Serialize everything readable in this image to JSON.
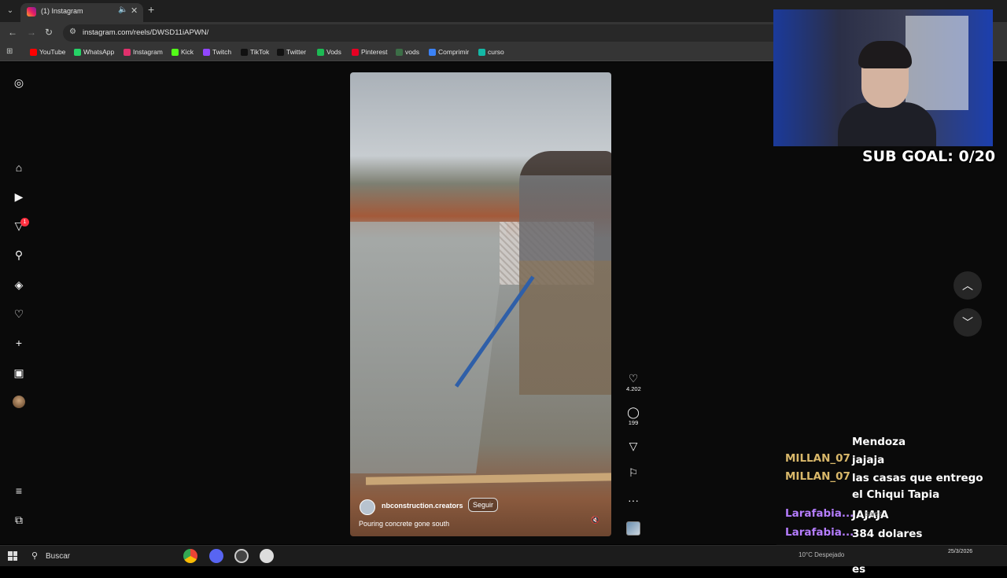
{
  "browser": {
    "tab": {
      "title": "(1) Instagram"
    },
    "address": {
      "url": "instagram.com/reels/DWSD11iAPWN/"
    },
    "bookmarks": [
      {
        "label": "YouTube",
        "color": "#ff0000"
      },
      {
        "label": "WhatsApp",
        "color": "#25d366"
      },
      {
        "label": "Instagram",
        "color": "#e1306c"
      },
      {
        "label": "Kick",
        "color": "#53fc18"
      },
      {
        "label": "Twitch",
        "color": "#9146ff"
      },
      {
        "label": "TikTok",
        "color": "#111111"
      },
      {
        "label": "Twitter",
        "color": "#111111"
      },
      {
        "label": "Vods",
        "color": "#1db954"
      },
      {
        "label": "Pinterest",
        "color": "#e60023"
      },
      {
        "label": "vods",
        "color": "#3c6e47"
      },
      {
        "label": "Comprimir",
        "color": "#3b82f6"
      },
      {
        "label": "curso",
        "color": "#14b8a6"
      }
    ]
  },
  "sidebar": {
    "notifications_badge": "1"
  },
  "reel": {
    "username": "nbconstruction.creators",
    "follow_label": "Seguir",
    "caption": "Pouring concrete gone south",
    "likes": "4.202",
    "comments": "199"
  },
  "stream": {
    "sub_goal": "SUB GOAL: 0/20",
    "chat": [
      {
        "user": "",
        "message": "Mendoza",
        "color": "#ffffff"
      },
      {
        "user": "MILLAN_07",
        "message": "jajaja",
        "color": "#d9b86a"
      },
      {
        "user": "MILLAN_07",
        "message": "las casas que entrego el Chiqui Tapia",
        "color": "#d9b86a"
      },
      {
        "user": "Larafabia...",
        "message": "JAJAJA",
        "color": "#b57dff"
      },
      {
        "user": "Larafabia...",
        "message": "384 dolares",
        "color": "#b57dff"
      },
      {
        "user": "Larafabia...",
        "message": "en que parte de suiza es",
        "color": "#b57dff"
      }
    ],
    "ghost_text": "sajes"
  },
  "taskbar": {
    "search_label": "Buscar",
    "weather": "10°C  Despejado",
    "date": "25/3/2026"
  }
}
